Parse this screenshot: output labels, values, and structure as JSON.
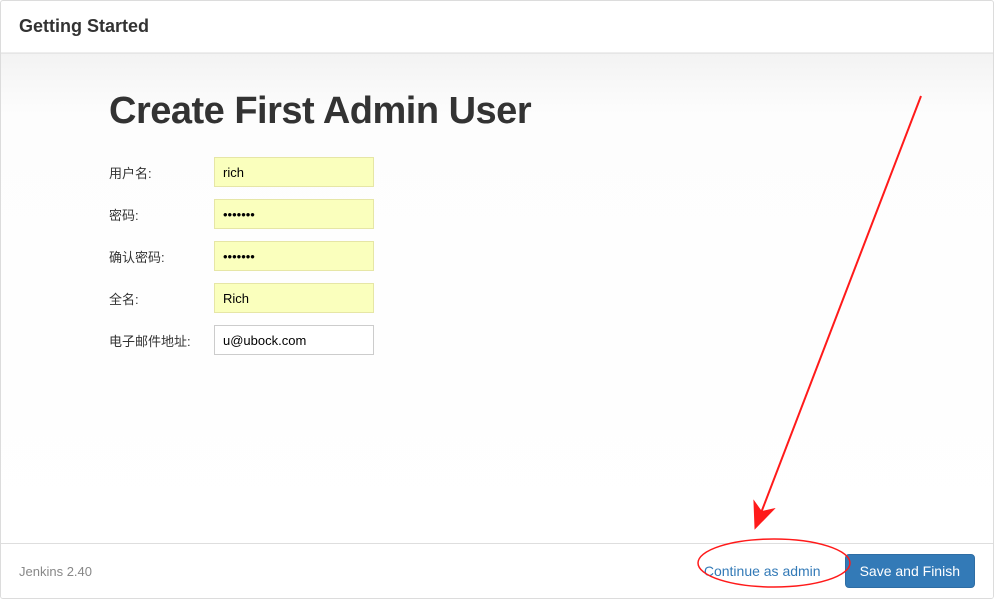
{
  "header": {
    "title": "Getting Started"
  },
  "page": {
    "title": "Create First Admin User"
  },
  "form": {
    "username": {
      "label": "用户名:",
      "value": "rich"
    },
    "password": {
      "label": "密码:",
      "value": "•••••••"
    },
    "confirm": {
      "label": "确认密码:",
      "value": "•••••••"
    },
    "fullname": {
      "label": "全名:",
      "value": "Rich"
    },
    "email": {
      "label": "电子邮件地址:",
      "value": "u@ubock.com"
    }
  },
  "footer": {
    "version": "Jenkins 2.40",
    "continue_label": "Continue as admin",
    "save_label": "Save and Finish"
  }
}
